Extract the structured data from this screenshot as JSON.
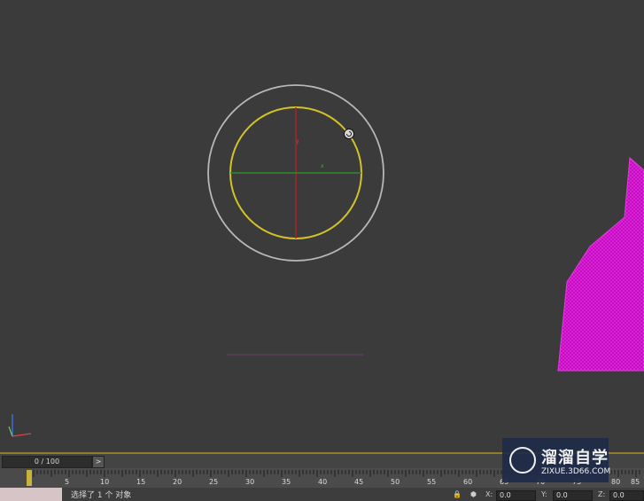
{
  "timeline": {
    "frame_display": "0 / 100",
    "next_label": ">",
    "ticks": [
      "5",
      "10",
      "15",
      "20",
      "25",
      "30",
      "35",
      "40",
      "45",
      "50",
      "55",
      "60",
      "65",
      "70",
      "75",
      "80",
      "85"
    ]
  },
  "status": {
    "message": "选择了 1 个 对象",
    "x_label": "X:",
    "x_value": "0.0",
    "y_label": "Y:",
    "y_value": "0.0",
    "z_label": "Z:",
    "z_value": "0.0"
  },
  "viewport": {
    "gizmo": {
      "y_axis_label": "y",
      "x_axis_label": "x"
    }
  },
  "watermark": {
    "title": "溜溜自学",
    "subtitle": "ZIXUE.3D66.COM"
  },
  "colors": {
    "mesh": "#d100c8",
    "gizmo_ring": "#d4c226",
    "outer_ring": "#b8b8b8",
    "x_axis": "#2c8b2c",
    "y_axis": "#b22222"
  }
}
